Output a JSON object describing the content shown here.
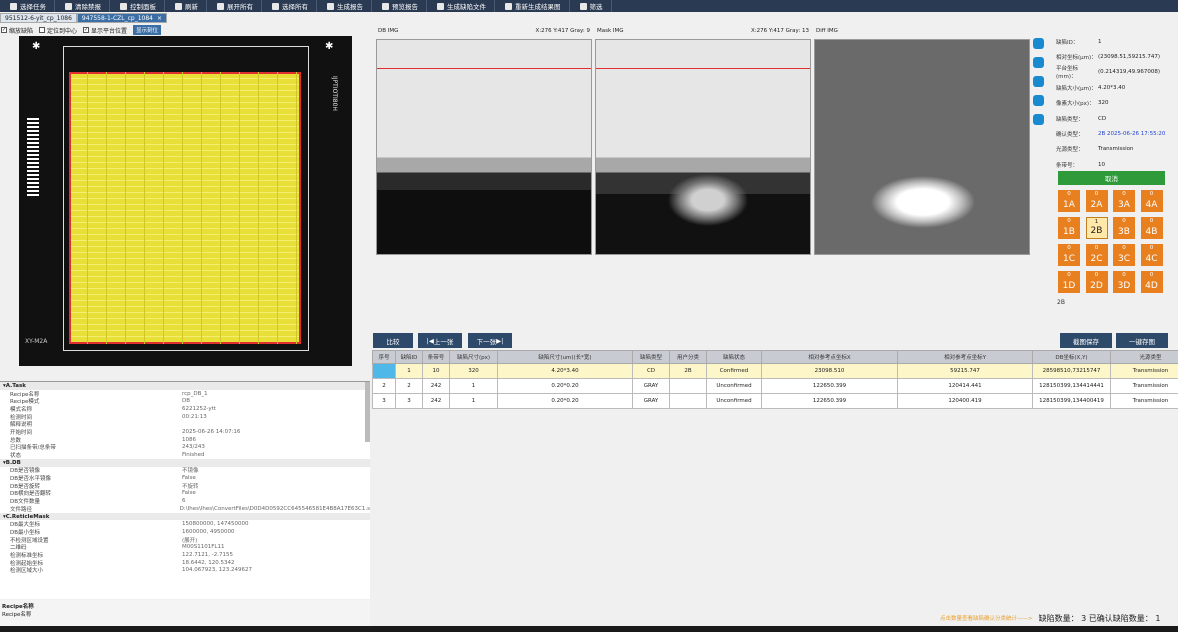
{
  "toolbar": {
    "items": [
      "选择任务",
      "清除禁报",
      "控制面板",
      "刷新",
      "展开所有",
      "选择所有",
      "生成报告",
      "预览报告",
      "生成缺陷文件",
      "重新生成结果图",
      "筛选"
    ]
  },
  "tabs": [
    "951512-6-yit_cp_1086",
    "947558-1-CZL_cp_1084"
  ],
  "options": {
    "zoom_defect": "缩放缺陷",
    "locate_center": "定位到中心",
    "show_stage": "显示平台位置",
    "show_marks": "显示刻位"
  },
  "wafer": {
    "side_text": "IJPTIOTI80H",
    "label": "XY-M2A"
  },
  "images": {
    "db": {
      "title": "DB IMG",
      "info": "X:276 Y:417 Gray: 9"
    },
    "mask": {
      "title": "Mask IMG",
      "info": "X:276 Y:417 Gray: 13"
    },
    "diff": {
      "title": "Diff IMG",
      "info": ""
    }
  },
  "info": {
    "rows": [
      {
        "k": "缺陷ID：",
        "v": "1"
      },
      {
        "k": "相对坐标(μm)：",
        "v": "(23098.51,59215.747)"
      },
      {
        "k": "平台坐标(mm)：",
        "v": "(0.214319,49.967008)"
      },
      {
        "k": "缺陷大小(μm)：",
        "v": "4.20*3.40"
      },
      {
        "k": "像素大小(px)：",
        "v": "320"
      },
      {
        "k": "缺陷类型：",
        "v": "CD"
      },
      {
        "k": "确认类型：",
        "v": "2B   2025-06-26 17:55:20"
      },
      {
        "k": "光源类型：",
        "v": "Transmission"
      },
      {
        "k": "条带号：",
        "v": "10"
      }
    ],
    "cancel_label": "取消"
  },
  "grade": {
    "buttons": [
      {
        "label": "1A",
        "count": "0"
      },
      {
        "label": "2A",
        "count": "0"
      },
      {
        "label": "3A",
        "count": "0"
      },
      {
        "label": "4A",
        "count": "0"
      },
      {
        "label": "1B",
        "count": "0"
      },
      {
        "label": "2B",
        "count": "1"
      },
      {
        "label": "3B",
        "count": "0"
      },
      {
        "label": "4B",
        "count": "0"
      },
      {
        "label": "1C",
        "count": "0"
      },
      {
        "label": "2C",
        "count": "0"
      },
      {
        "label": "3C",
        "count": "0"
      },
      {
        "label": "4C",
        "count": "0"
      },
      {
        "label": "1D",
        "count": "0"
      },
      {
        "label": "2D",
        "count": "0"
      },
      {
        "label": "3D",
        "count": "0"
      },
      {
        "label": "4D",
        "count": "0"
      }
    ],
    "selected_text": "2B"
  },
  "nav": {
    "compare": "比较",
    "prev": "上一张",
    "next": "下一张",
    "save_screenshot": "截图保存",
    "save_all": "一键存图"
  },
  "table": {
    "headers": [
      "序号",
      "缺陷ID",
      "条带号",
      "缺陷尺寸(px)",
      "缺陷尺寸(um)(长*宽)",
      "缺陷类型",
      "用户分类",
      "缺陷状态",
      "相对参考点坐标X",
      "相对参考点坐标Y",
      "DB坐标(X,Y)",
      "光源类型"
    ],
    "rows": [
      [
        "",
        "1",
        "10",
        "320",
        "4.20*3.40",
        "CD",
        "2B",
        "Confirmed",
        "23098.510",
        "59215.747",
        "28598510,73215747",
        "Transmission"
      ],
      [
        "2",
        "2",
        "242",
        "1",
        "0.20*0.20",
        "GRAY",
        "",
        "Unconfirmed",
        "122650.399",
        "120414.441",
        "128150399,134414441",
        "Transmission"
      ],
      [
        "3",
        "3",
        "242",
        "1",
        "0.20*0.20",
        "GRAY",
        "",
        "Unconfirmed",
        "122650.399",
        "120400.419",
        "128150399,134400419",
        "Transmission"
      ]
    ]
  },
  "tree": {
    "groups": [
      {
        "title": "A.Task",
        "rows": [
          [
            "Recipe名称",
            "rcp_DB_1"
          ],
          [
            "Recipe模式",
            "DB"
          ],
          [
            "模式名称",
            "6221252-ytt"
          ],
          [
            "检测时间",
            "00:21:13"
          ],
          [
            "解释说明",
            ""
          ],
          [
            "开始时间",
            "2025-06-26 14:07:16"
          ],
          [
            "总数",
            "1086"
          ],
          [
            "已扫描条带/总条带",
            "243/243"
          ],
          [
            "状态",
            "Finished"
          ]
        ]
      },
      {
        "title": "B.DB",
        "rows": [
          [
            "DB是否镜像",
            "不镜像"
          ],
          [
            "DB是否水平镜像",
            "False"
          ],
          [
            "DB是否旋转",
            "不旋转"
          ],
          [
            "DB横向是否翻转",
            "False"
          ],
          [
            "DB文件数量",
            "6"
          ],
          [
            "文件路径",
            "D:\\Ihes\\Ihes\\ConvertFiles\\D0D4D0592CC645546581E4B8A17E63C1.s"
          ]
        ]
      },
      {
        "title": "C.ReticleMask",
        "rows": [
          [
            "DB最大坐标",
            "150800000, 147450000"
          ],
          [
            "DB最小坐标",
            "1600000, 4950000"
          ],
          [
            "不检测区域设置",
            "(展开)"
          ],
          [
            "二维码",
            "M00S1101FL11"
          ],
          [
            "检测标准坐标",
            "122.7121, -2.7155"
          ],
          [
            "检测起始坐标",
            "18.6442, 120.5342"
          ],
          [
            "检测区域大小",
            "104.067923, 123.249627"
          ]
        ]
      }
    ]
  },
  "desc": {
    "title": "Recipe名称",
    "text": "Recipe名称"
  },
  "status": {
    "link": "点击数量查看缺陷确认分类统计——>",
    "count": "缺陷数量：  3 已确认缺陷数量：  1"
  },
  "colors": {
    "toolbar": "#2a3a52",
    "grade": "#e88020",
    "accent": "#3a6ea5",
    "cancel": "#2e9a3a"
  }
}
